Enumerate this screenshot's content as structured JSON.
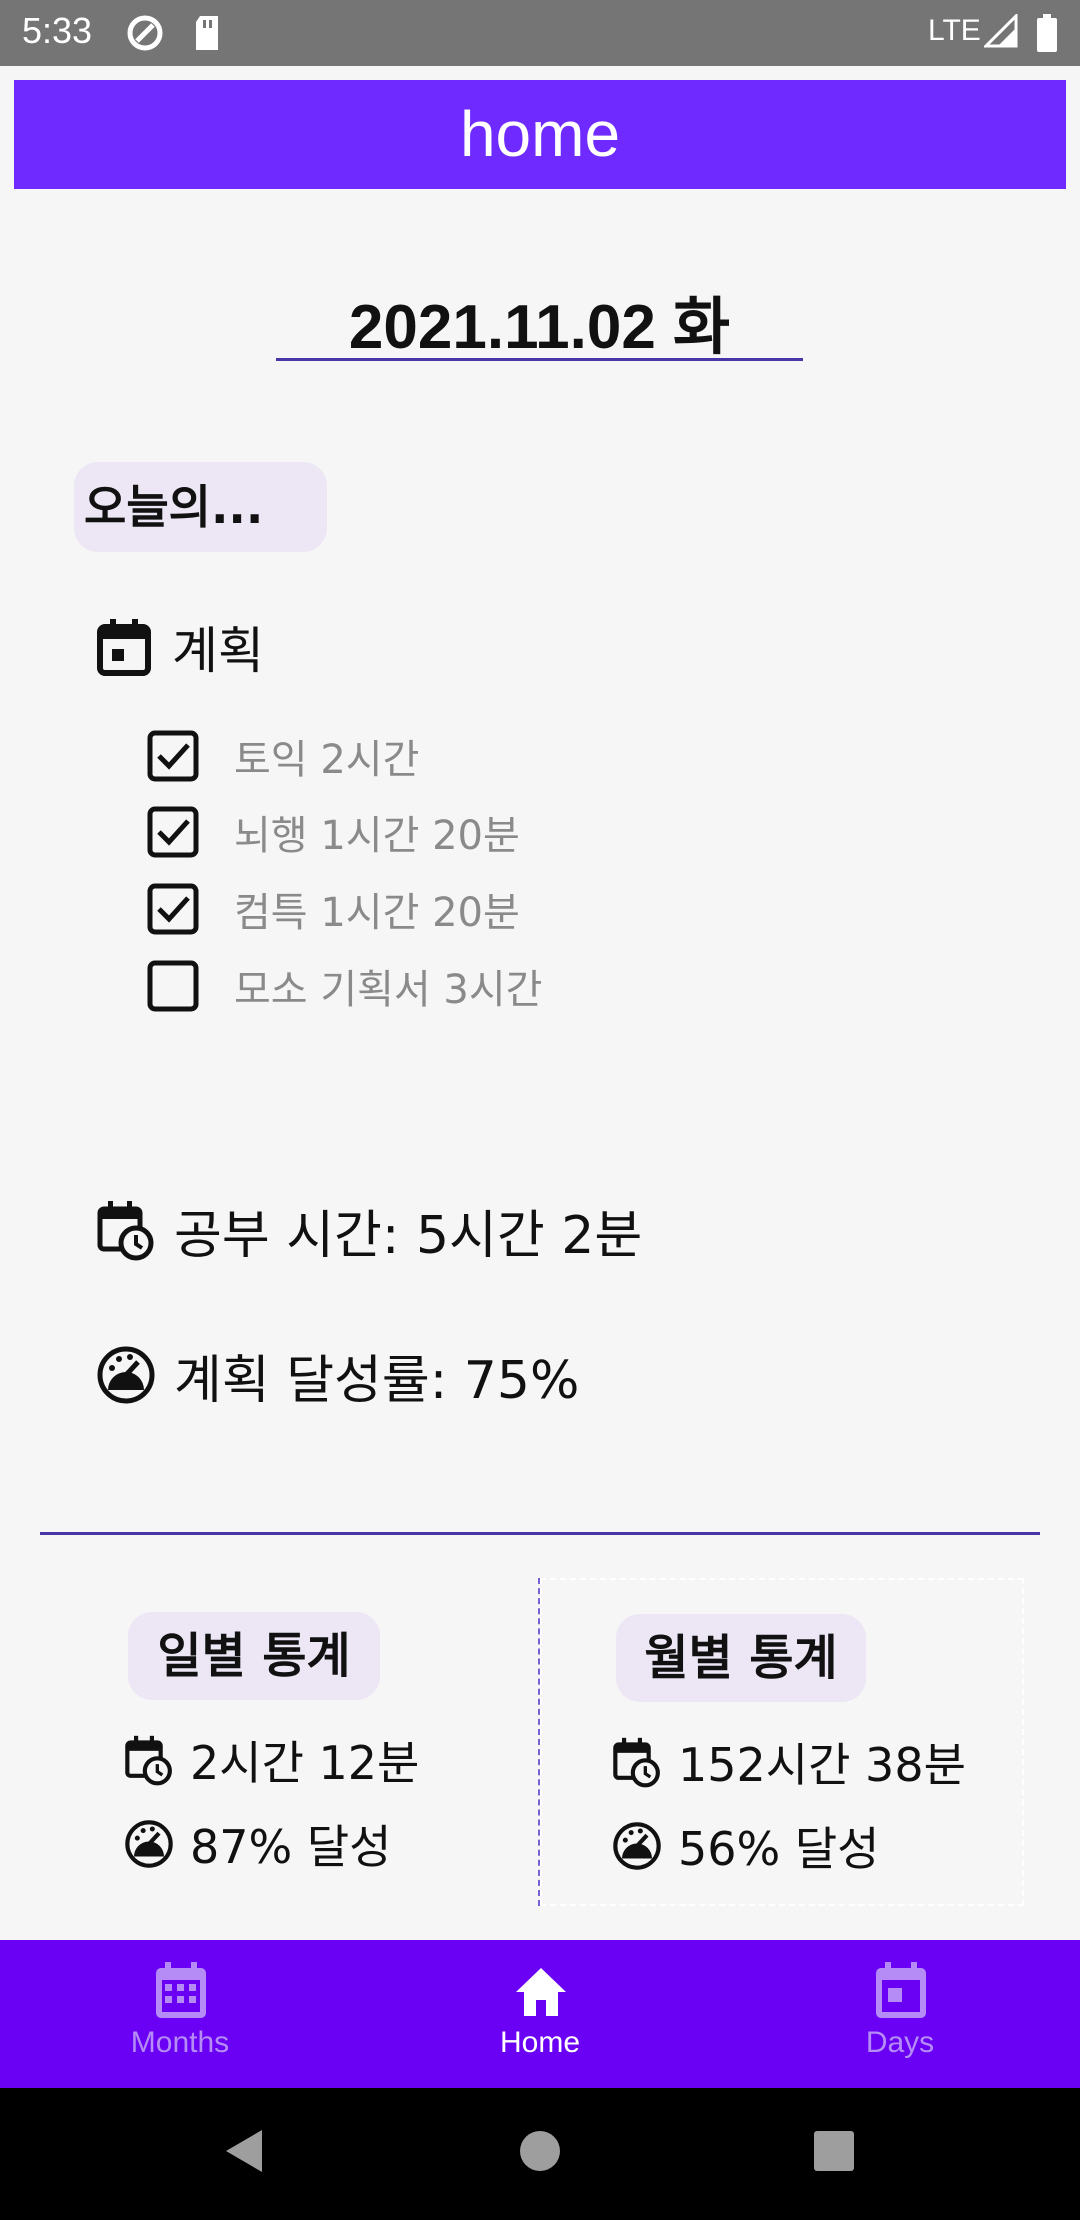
{
  "status_bar": {
    "time": "5:33",
    "network": "LTE",
    "icons": [
      "at-sign-icon",
      "sd-card-icon",
      "signal-icon",
      "battery-icon"
    ]
  },
  "app_bar": {
    "title": "home"
  },
  "date": {
    "value": "2021.11.02 화"
  },
  "today": {
    "chip": "오늘의...",
    "plan_label": "계획",
    "todos": [
      {
        "text": "토익 2시간",
        "checked": true
      },
      {
        "text": "뇌행 1시간 20분",
        "checked": true
      },
      {
        "text": "컴특 1시간 20분",
        "checked": true
      },
      {
        "text": "모소 기획서 3시간",
        "checked": false
      }
    ],
    "study_time": "공부 시간: 5시간 2분",
    "achievement": "계획 달성률: 75%"
  },
  "daily_stats": {
    "title": "일별 통계",
    "time": "2시간 12분",
    "rate": "87% 달성"
  },
  "monthly_stats": {
    "title": "월별 통계",
    "time": "152시간 38분",
    "rate": "56% 달성"
  },
  "bottom_nav": {
    "items": [
      {
        "label": "Months",
        "icon": "calendar-grid-icon",
        "active": false
      },
      {
        "label": "Home",
        "icon": "home-icon",
        "active": true
      },
      {
        "label": "Days",
        "icon": "calendar-day-icon",
        "active": false
      }
    ]
  },
  "colors": {
    "primary": "#6f2bff",
    "nav_background": "#6a00f4",
    "accent_line": "#4a35a8",
    "chip_background": "#ece6f5",
    "inactive_nav": "#b58cf5"
  }
}
